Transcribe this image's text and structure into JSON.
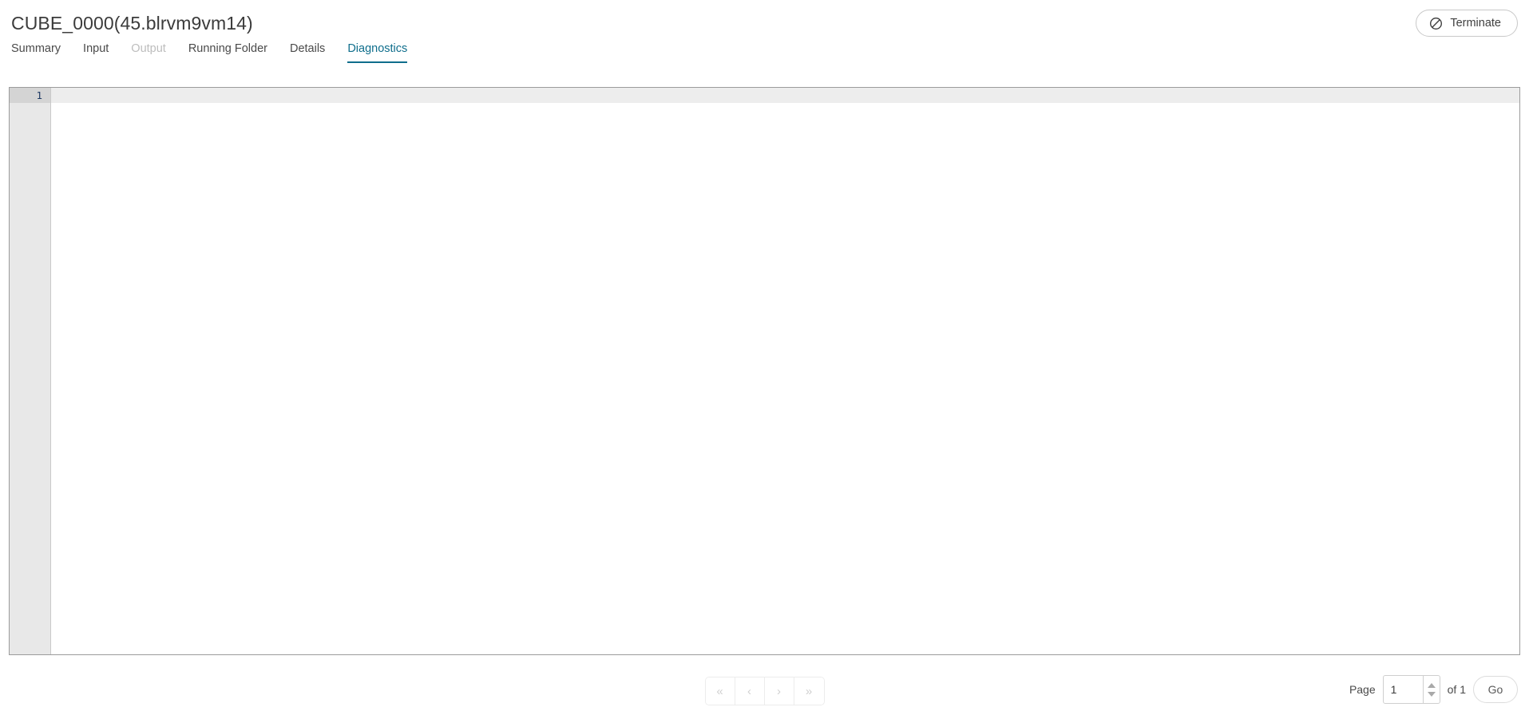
{
  "header": {
    "title": "CUBE_0000(45.blrvm9vm14)",
    "terminate_label": "Terminate",
    "terminate_icon": "no-entry-icon",
    "terminate_icon_color": "#3b3b3b"
  },
  "tabs": {
    "active_index": 5,
    "active_color": "#0f6e8c",
    "items": [
      {
        "label": "Summary",
        "state": "enabled"
      },
      {
        "label": "Input",
        "state": "enabled"
      },
      {
        "label": "Output",
        "state": "disabled"
      },
      {
        "label": "Running Folder",
        "state": "enabled"
      },
      {
        "label": "Details",
        "state": "enabled"
      },
      {
        "label": "Diagnostics",
        "state": "active"
      }
    ]
  },
  "editor": {
    "line_numbers": [
      "1"
    ],
    "lines": [
      ""
    ],
    "active_line": 1,
    "gutter_bg": "#e8e8e8",
    "active_line_bg": "#ededed",
    "active_gutter_bg": "#d4d4d4",
    "line_number_color": "#1f3a63"
  },
  "footer": {
    "pagination": {
      "first_label": "«",
      "prev_label": "‹",
      "next_label": "›",
      "last_label": "»",
      "disabled": true
    },
    "page_label": "Page",
    "page_value": "1",
    "page_placeholder": "",
    "total_label": "of 1",
    "go_label": "Go",
    "spinner_up_icon": "chevron-up-icon",
    "spinner_down_icon": "chevron-down-icon"
  }
}
